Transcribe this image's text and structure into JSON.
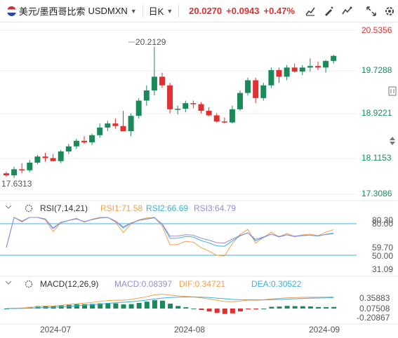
{
  "toolbar": {
    "name": "美元/墨西哥比索",
    "code": "USDMXN",
    "period": "日K",
    "price": "20.0270",
    "change": "+0.0943",
    "change_pct": "+0.47%",
    "icons": [
      "chart-type-icon",
      "drawing-icon",
      "indicator-icon",
      "fullscreen-icon",
      "settings-icon"
    ]
  },
  "main": {
    "y_ticks": [
      "20.5356",
      "19.7288",
      "18.9221",
      "18.1153",
      "17.3086"
    ],
    "high_label": "20.2129",
    "low_label": "17.6313"
  },
  "rsi": {
    "title": "RSI(7,14,21)",
    "rsi1": "RSI1:71.58",
    "rsi2": "RSI2:66.69",
    "rsi3": "RSI3:64.79",
    "levels": [
      "80.00",
      "80.30",
      "59.70",
      "50.00",
      "31.09"
    ]
  },
  "macd": {
    "title": "MACD(12,26,9)",
    "macd": "MACD:0.08397",
    "dif": "DIF:0.34721",
    "dea": "DEA:0.30522",
    "y_ticks": [
      "0.35883",
      "0.07508",
      "-0.20867"
    ]
  },
  "x_axis": [
    "2024-07",
    "2024-08",
    "2024-09"
  ],
  "colors": {
    "up": "#1a8a5a",
    "down": "#e03030",
    "rsi1": "#f0a050",
    "rsi2": "#3ab0e0",
    "rsi3": "#9a8ad8",
    "axis_green": "#1a8a5a",
    "axis_red": "#e03030"
  },
  "chart_data": {
    "type": "candlestick",
    "y_range": [
      17.3086,
      20.5356
    ],
    "candles": [
      [
        17.72,
        17.75,
        17.65,
        17.68
      ],
      [
        17.68,
        17.85,
        17.63,
        17.8
      ],
      [
        17.8,
        17.92,
        17.72,
        17.78
      ],
      [
        17.78,
        17.98,
        17.74,
        17.93
      ],
      [
        17.93,
        18.08,
        17.9,
        18.05
      ],
      [
        18.05,
        18.12,
        17.95,
        18.02
      ],
      [
        18.02,
        18.1,
        17.97,
        17.96
      ],
      [
        17.96,
        18.18,
        17.92,
        18.15
      ],
      [
        18.15,
        18.3,
        18.1,
        18.25
      ],
      [
        18.25,
        18.4,
        18.2,
        18.36
      ],
      [
        18.36,
        18.45,
        18.3,
        18.33
      ],
      [
        18.33,
        18.5,
        18.28,
        18.47
      ],
      [
        18.47,
        18.7,
        18.42,
        18.62
      ],
      [
        18.62,
        18.75,
        18.55,
        18.7
      ],
      [
        18.7,
        18.8,
        18.6,
        18.65
      ],
      [
        18.65,
        18.95,
        18.6,
        18.55
      ],
      [
        18.55,
        18.9,
        18.45,
        18.85
      ],
      [
        18.85,
        19.2,
        18.8,
        19.15
      ],
      [
        19.15,
        19.45,
        19.05,
        19.35
      ],
      [
        19.35,
        20.21,
        19.25,
        19.62
      ],
      [
        19.62,
        19.7,
        19.4,
        19.45
      ],
      [
        19.45,
        19.5,
        18.9,
        18.98
      ],
      [
        18.98,
        19.05,
        18.88,
        18.99
      ],
      [
        18.99,
        19.15,
        18.92,
        19.1
      ],
      [
        19.1,
        19.15,
        19.0,
        19.08
      ],
      [
        19.08,
        19.12,
        18.9,
        18.95
      ],
      [
        18.95,
        19.02,
        18.84,
        18.86
      ],
      [
        18.86,
        18.9,
        18.72,
        18.74
      ],
      [
        18.74,
        18.82,
        18.7,
        18.72
      ],
      [
        18.72,
        19.05,
        18.7,
        18.98
      ],
      [
        18.98,
        19.35,
        18.95,
        19.3
      ],
      [
        19.3,
        19.6,
        19.25,
        19.55
      ],
      [
        19.55,
        19.6,
        19.1,
        19.2
      ],
      [
        19.2,
        19.5,
        19.15,
        19.45
      ],
      [
        19.45,
        19.8,
        19.4,
        19.75
      ],
      [
        19.75,
        19.8,
        19.5,
        19.62
      ],
      [
        19.62,
        19.85,
        19.55,
        19.8
      ],
      [
        19.8,
        19.88,
        19.7,
        19.72
      ],
      [
        19.72,
        19.85,
        19.65,
        19.8
      ],
      [
        19.8,
        19.98,
        19.72,
        19.83
      ],
      [
        19.83,
        19.92,
        19.75,
        19.8
      ],
      [
        19.8,
        19.95,
        19.7,
        19.93
      ],
      [
        19.93,
        20.05,
        19.88,
        20.03
      ]
    ]
  }
}
